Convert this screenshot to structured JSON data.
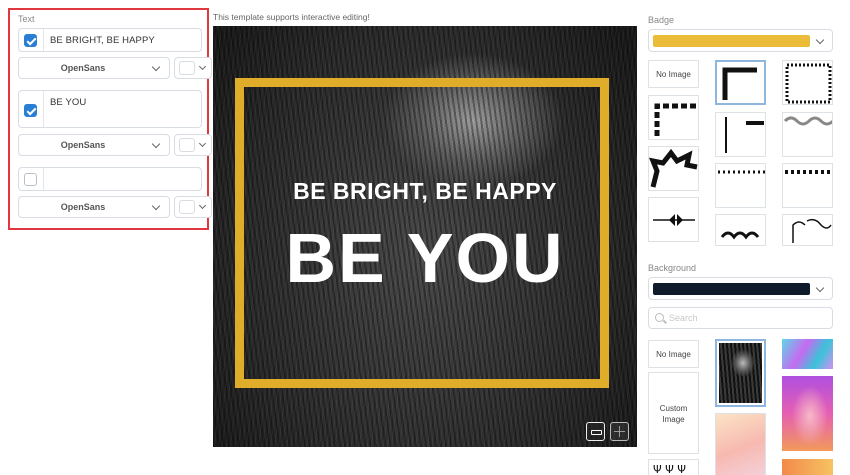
{
  "text_panel": {
    "label": "Text",
    "rows": [
      {
        "checked": true,
        "text": "BE BRIGHT, BE HAPPY",
        "font": "OpenSans"
      },
      {
        "checked": true,
        "text": "BE YOU",
        "font": "OpenSans"
      },
      {
        "checked": false,
        "text": "",
        "font": "OpenSans"
      }
    ]
  },
  "canvas": {
    "hint": "This template supports interactive editing!",
    "line1": "BE BRIGHT, BE HAPPY",
    "line2": "BE YOU",
    "frame_color": "#e0ad2a"
  },
  "badge": {
    "label": "Badge",
    "selected_color": "#ebbc3a",
    "no_image": "No Image"
  },
  "background": {
    "label": "Background",
    "selected_color": "#0f1b2a",
    "search_placeholder": "Search",
    "no_image": "No Image",
    "custom_image": "Custom Image"
  },
  "icons": {
    "checkbox": "check-icon",
    "dropdown": "chevron-down-icon",
    "search": "search-icon",
    "zoom_out": "zoom-out-icon",
    "zoom_in": "zoom-in-icon"
  }
}
